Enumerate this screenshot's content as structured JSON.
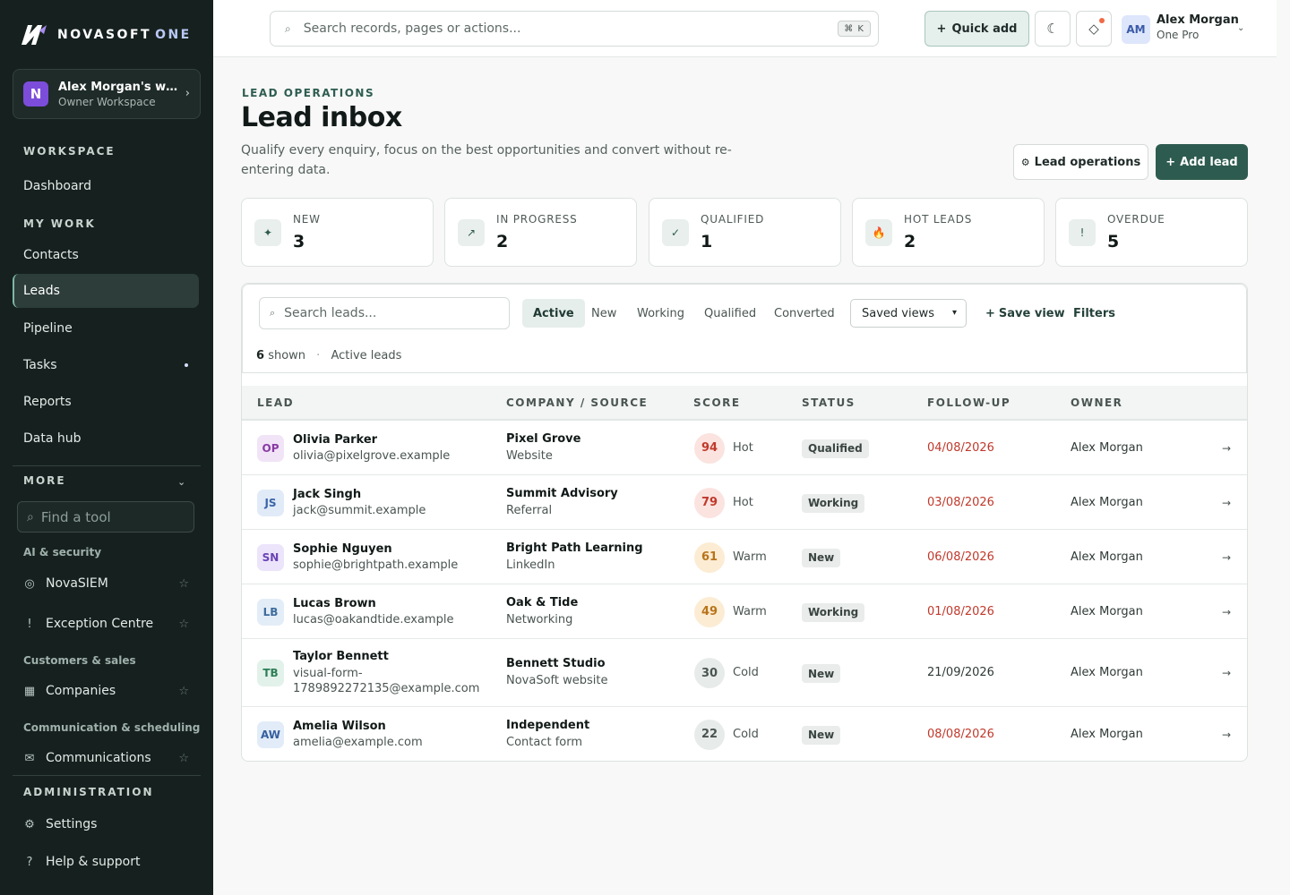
{
  "brand": {
    "name": "NOVASOFT",
    "suffix": "ONE"
  },
  "workspace": {
    "initial": "N",
    "name": "Alex Morgan's workspace",
    "role": "Owner Workspace"
  },
  "sidebar": {
    "workspace_label": "WORKSPACE",
    "dashboard": "Dashboard",
    "my_work_label": "MY WORK",
    "items": [
      {
        "label": "Contacts"
      },
      {
        "label": "Leads"
      },
      {
        "label": "Pipeline"
      },
      {
        "label": "Tasks"
      },
      {
        "label": "Reports"
      },
      {
        "label": "Data hub"
      }
    ],
    "more_label": "MORE",
    "find_placeholder": "Find a tool",
    "groups": [
      {
        "label": "AI & security",
        "tools": [
          {
            "label": "NovaSIEM",
            "icon": "target-icon"
          },
          {
            "label": "Exception Centre",
            "icon": "exclamation-icon"
          }
        ]
      },
      {
        "label": "Customers & sales",
        "tools": [
          {
            "label": "Companies",
            "icon": "building-icon"
          }
        ]
      },
      {
        "label": "Communication & scheduling",
        "tools": [
          {
            "label": "Communications",
            "icon": "mail-icon"
          }
        ]
      }
    ],
    "admin_label": "ADMINISTRATION",
    "settings": "Settings",
    "help": "Help & support"
  },
  "topbar": {
    "search_placeholder": "Search records, pages or actions...",
    "shortcut": "⌘ K",
    "quick_add": "Quick add",
    "user": {
      "initials": "AM",
      "name": "Alex Morgan",
      "plan": "One Pro"
    }
  },
  "page": {
    "eyebrow": "LEAD OPERATIONS",
    "title": "Lead inbox",
    "description": "Qualify every enquiry, focus on the best opportunities and convert without re-entering data.",
    "ops_button": "Lead operations",
    "add_button": "Add lead"
  },
  "stats": [
    {
      "label": "NEW",
      "value": "3",
      "icon": "sparkle-icon"
    },
    {
      "label": "IN PROGRESS",
      "value": "2",
      "icon": "trend-up-icon"
    },
    {
      "label": "QUALIFIED",
      "value": "1",
      "icon": "check-icon"
    },
    {
      "label": "HOT LEADS",
      "value": "2",
      "icon": "fire-icon"
    },
    {
      "label": "OVERDUE",
      "value": "5",
      "icon": "exclamation-icon"
    }
  ],
  "filters": {
    "search_placeholder": "Search leads...",
    "tabs": [
      "Active",
      "New",
      "Working",
      "Qualified",
      "Converted"
    ],
    "active_tab": "Active",
    "saved_views": "Saved views",
    "save_view": "Save view",
    "filters": "Filters",
    "shown_count": "6",
    "shown_label": "shown",
    "view_name": "Active leads"
  },
  "table": {
    "headers": [
      "LEAD",
      "COMPANY / SOURCE",
      "SCORE",
      "STATUS",
      "FOLLOW-UP",
      "OWNER"
    ],
    "rows": [
      {
        "initials": "OP",
        "name": "Olivia Parker",
        "email": "olivia@pixelgrove.example",
        "company": "Pixel Grove",
        "source": "Website",
        "score": "94",
        "temperature": "Hot",
        "status": "Qualified",
        "follow_up": "04/08/2026",
        "overdue": true,
        "owner": "Alex Morgan"
      },
      {
        "initials": "JS",
        "name": "Jack Singh",
        "email": "jack@summit.example",
        "company": "Summit Advisory",
        "source": "Referral",
        "score": "79",
        "temperature": "Hot",
        "status": "Working",
        "follow_up": "03/08/2026",
        "overdue": true,
        "owner": "Alex Morgan"
      },
      {
        "initials": "SN",
        "name": "Sophie Nguyen",
        "email": "sophie@brightpath.example",
        "company": "Bright Path Learning",
        "source": "LinkedIn",
        "score": "61",
        "temperature": "Warm",
        "status": "New",
        "follow_up": "06/08/2026",
        "overdue": true,
        "owner": "Alex Morgan"
      },
      {
        "initials": "LB",
        "name": "Lucas Brown",
        "email": "lucas@oakandtide.example",
        "company": "Oak & Tide",
        "source": "Networking",
        "score": "49",
        "temperature": "Warm",
        "status": "Working",
        "follow_up": "01/08/2026",
        "overdue": true,
        "owner": "Alex Morgan"
      },
      {
        "initials": "TB",
        "name": "Taylor Bennett",
        "email": "visual-form-1789892272135@example.com",
        "company": "Bennett Studio",
        "source": "NovaSoft website",
        "score": "30",
        "temperature": "Cold",
        "status": "New",
        "follow_up": "21/09/2026",
        "overdue": false,
        "owner": "Alex Morgan"
      },
      {
        "initials": "AW",
        "name": "Amelia Wilson",
        "email": "amelia@example.com",
        "company": "Independent",
        "source": "Contact form",
        "score": "22",
        "temperature": "Cold",
        "status": "New",
        "follow_up": "08/08/2026",
        "overdue": true,
        "owner": "Alex Morgan"
      }
    ]
  },
  "colors": {
    "sidebar_bg": "#16211f",
    "accent": "#2e5b4f",
    "overdue_text": "#c0392b",
    "hot_score_bg": "#fbe3e0",
    "warm_score_bg": "#fcecd4",
    "cold_score_bg": "#e7ebea"
  }
}
